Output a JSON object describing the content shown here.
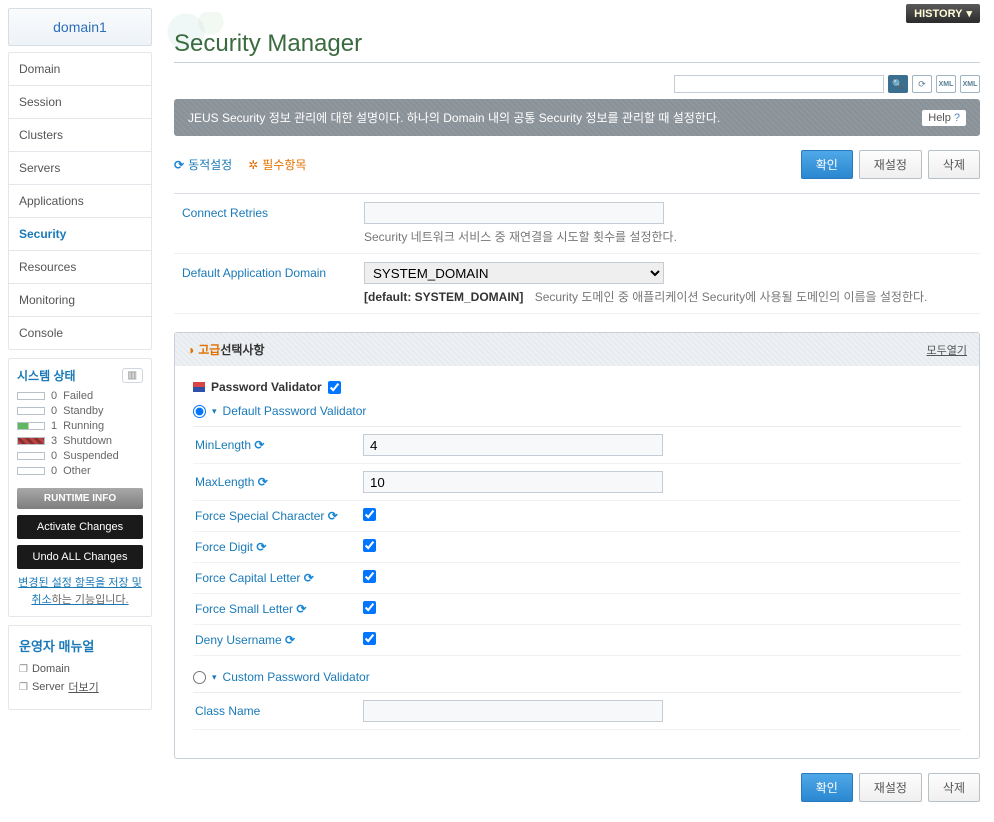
{
  "sidebar": {
    "domainTitle": "domain1",
    "nav": [
      {
        "label": "Domain"
      },
      {
        "label": "Session"
      },
      {
        "label": "Clusters"
      },
      {
        "label": "Servers"
      },
      {
        "label": "Applications"
      },
      {
        "label": "Security"
      },
      {
        "label": "Resources"
      },
      {
        "label": "Monitoring"
      },
      {
        "label": "Console"
      }
    ],
    "sysStatusTitle": "시스템 상태",
    "status": [
      {
        "count": "0",
        "label": "Failed",
        "cls": ""
      },
      {
        "count": "0",
        "label": "Standby",
        "cls": ""
      },
      {
        "count": "1",
        "label": "Running",
        "cls": "running"
      },
      {
        "count": "3",
        "label": "Shutdown",
        "cls": "shutdown"
      },
      {
        "count": "0",
        "label": "Suspended",
        "cls": ""
      },
      {
        "count": "0",
        "label": "Other",
        "cls": ""
      }
    ],
    "runtimeInfo": "RUNTIME INFO",
    "activate": "Activate Changes",
    "undo": "Undo ALL Changes",
    "changeDesc1": "변경된 설정 항목을 저장 및 취소",
    "changeDesc2": "하는 기능입니다.",
    "manualTitle": "운영자 매뉴얼",
    "manualItems": [
      {
        "label": "Domain"
      },
      {
        "label": "Server"
      }
    ],
    "more": "더보기"
  },
  "main": {
    "history": "HISTORY",
    "pageTitle": "Security Manager",
    "descBar": "JEUS Security 정보 관리에 대한 설명이다. 하나의 Domain 내의 공통 Security 정보를 관리할 때 설정한다.",
    "help": "Help",
    "legendDynamic": "동적설정",
    "legendRequired": "필수항목",
    "btnOk": "확인",
    "btnReset": "재설정",
    "btnDelete": "삭제",
    "form": {
      "connectRetriesLabel": "Connect Retries",
      "connectRetriesValue": "",
      "connectRetriesHint": "Security 네트워크 서비스 중 재연결을 시도할 횟수를 설정한다.",
      "defaultAppDomainLabel": "Default Application Domain",
      "defaultAppDomainValue": "SYSTEM_DOMAIN",
      "defaultAppDomainDefault": "[default: SYSTEM_DOMAIN]",
      "defaultAppDomainHint": "Security 도메인 중 애플리케이션 Security에 사용될 도메인의 이름을 설정한다."
    },
    "adv": {
      "title1": "고급",
      "title2": " 선택사항",
      "openAll": "모두열기",
      "pwdValidator": "Password Validator",
      "defaultPwdValidator": "Default Password Validator",
      "customPwdValidator": "Custom Password Validator",
      "minLengthLabel": "MinLength",
      "minLengthValue": "4",
      "maxLengthLabel": "MaxLength",
      "maxLengthValue": "10",
      "forceSpecial": "Force Special Character",
      "forceDigit": "Force Digit",
      "forceCapital": "Force Capital Letter",
      "forceSmall": "Force Small Letter",
      "denyUsername": "Deny Username",
      "classNameLabel": "Class Name",
      "classNameValue": ""
    }
  }
}
